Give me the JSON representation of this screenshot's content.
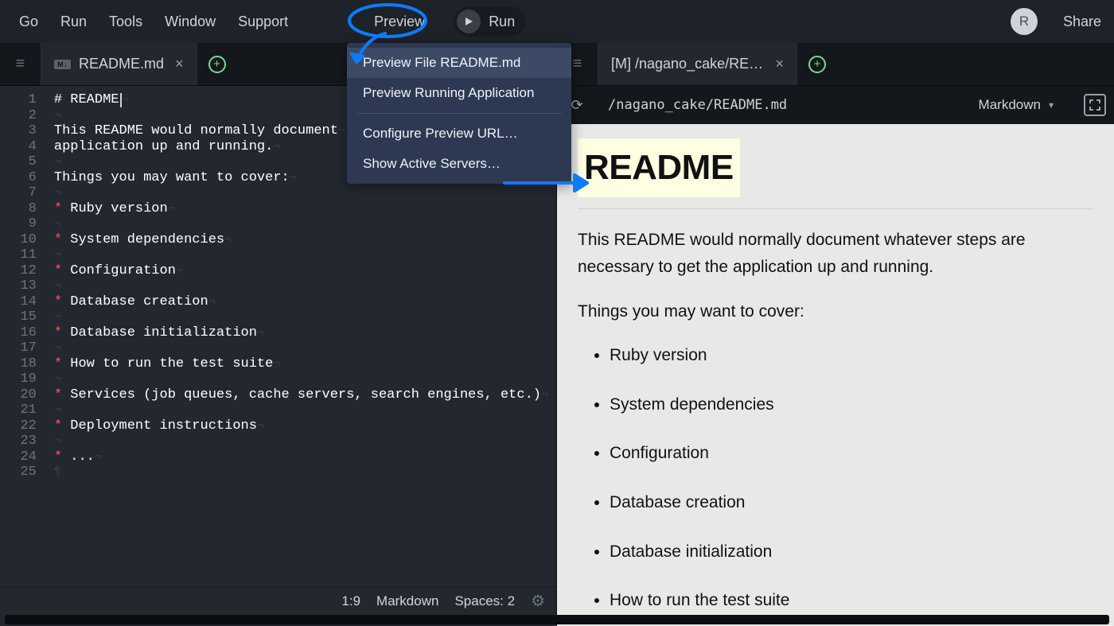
{
  "menubar": {
    "items": [
      "Go",
      "Run",
      "Tools",
      "Window",
      "Support"
    ],
    "preview": "Preview",
    "run_label": "Run",
    "share": "Share",
    "avatar_initial": "R"
  },
  "dropdown": {
    "items": [
      "Preview File README.md",
      "Preview Running Application",
      "Configure Preview URL…",
      "Show Active Servers…"
    ]
  },
  "left": {
    "tab": {
      "badge": "M↓",
      "label": "README.md"
    },
    "status": {
      "pos": "1:9",
      "syntax": "Markdown",
      "spaces": "Spaces: 2"
    },
    "lines": [
      {
        "n": 1,
        "pre": "# ",
        "rest": "README",
        "cursor": true
      },
      {
        "n": 2,
        "pre": "",
        "rest": ""
      },
      {
        "n": 3,
        "pre": "",
        "rest": "This README would normally document"
      },
      {
        "n": 4,
        "pre": "",
        "rest": "application up and running."
      },
      {
        "n": 5,
        "pre": "",
        "rest": ""
      },
      {
        "n": 6,
        "pre": "",
        "rest": "Things you may want to cover:"
      },
      {
        "n": 7,
        "pre": "",
        "rest": ""
      },
      {
        "n": 8,
        "pre": "* ",
        "rest": "Ruby version"
      },
      {
        "n": 9,
        "pre": "",
        "rest": ""
      },
      {
        "n": 10,
        "pre": "* ",
        "rest": "System dependencies"
      },
      {
        "n": 11,
        "pre": "",
        "rest": ""
      },
      {
        "n": 12,
        "pre": "* ",
        "rest": "Configuration"
      },
      {
        "n": 13,
        "pre": "",
        "rest": ""
      },
      {
        "n": 14,
        "pre": "* ",
        "rest": "Database creation"
      },
      {
        "n": 15,
        "pre": "",
        "rest": ""
      },
      {
        "n": 16,
        "pre": "* ",
        "rest": "Database initialization"
      },
      {
        "n": 17,
        "pre": "",
        "rest": ""
      },
      {
        "n": 18,
        "pre": "* ",
        "rest": "How to run the test suite"
      },
      {
        "n": 19,
        "pre": "",
        "rest": ""
      },
      {
        "n": 20,
        "pre": "* ",
        "rest": "Services (job queues, cache servers, search engines, etc.)"
      },
      {
        "n": 21,
        "pre": "",
        "rest": ""
      },
      {
        "n": 22,
        "pre": "* ",
        "rest": "Deployment instructions"
      },
      {
        "n": 23,
        "pre": "",
        "rest": ""
      },
      {
        "n": 24,
        "pre": "* ",
        "rest": "..."
      },
      {
        "n": 25,
        "pre": "",
        "rest": "",
        "para": true
      }
    ]
  },
  "right": {
    "tab": {
      "label": "[M] /nagano_cake/READM"
    },
    "toolbar": {
      "path": "/nagano_cake/README.md",
      "mode": "Markdown"
    },
    "preview": {
      "h1": "README",
      "p1": "This README would normally document whatever steps are necessary to get the application up and running.",
      "p2": "Things you may want to cover:",
      "bullets": [
        "Ruby version",
        "System dependencies",
        "Configuration",
        "Database creation",
        "Database initialization",
        "How to run the test suite"
      ]
    }
  }
}
